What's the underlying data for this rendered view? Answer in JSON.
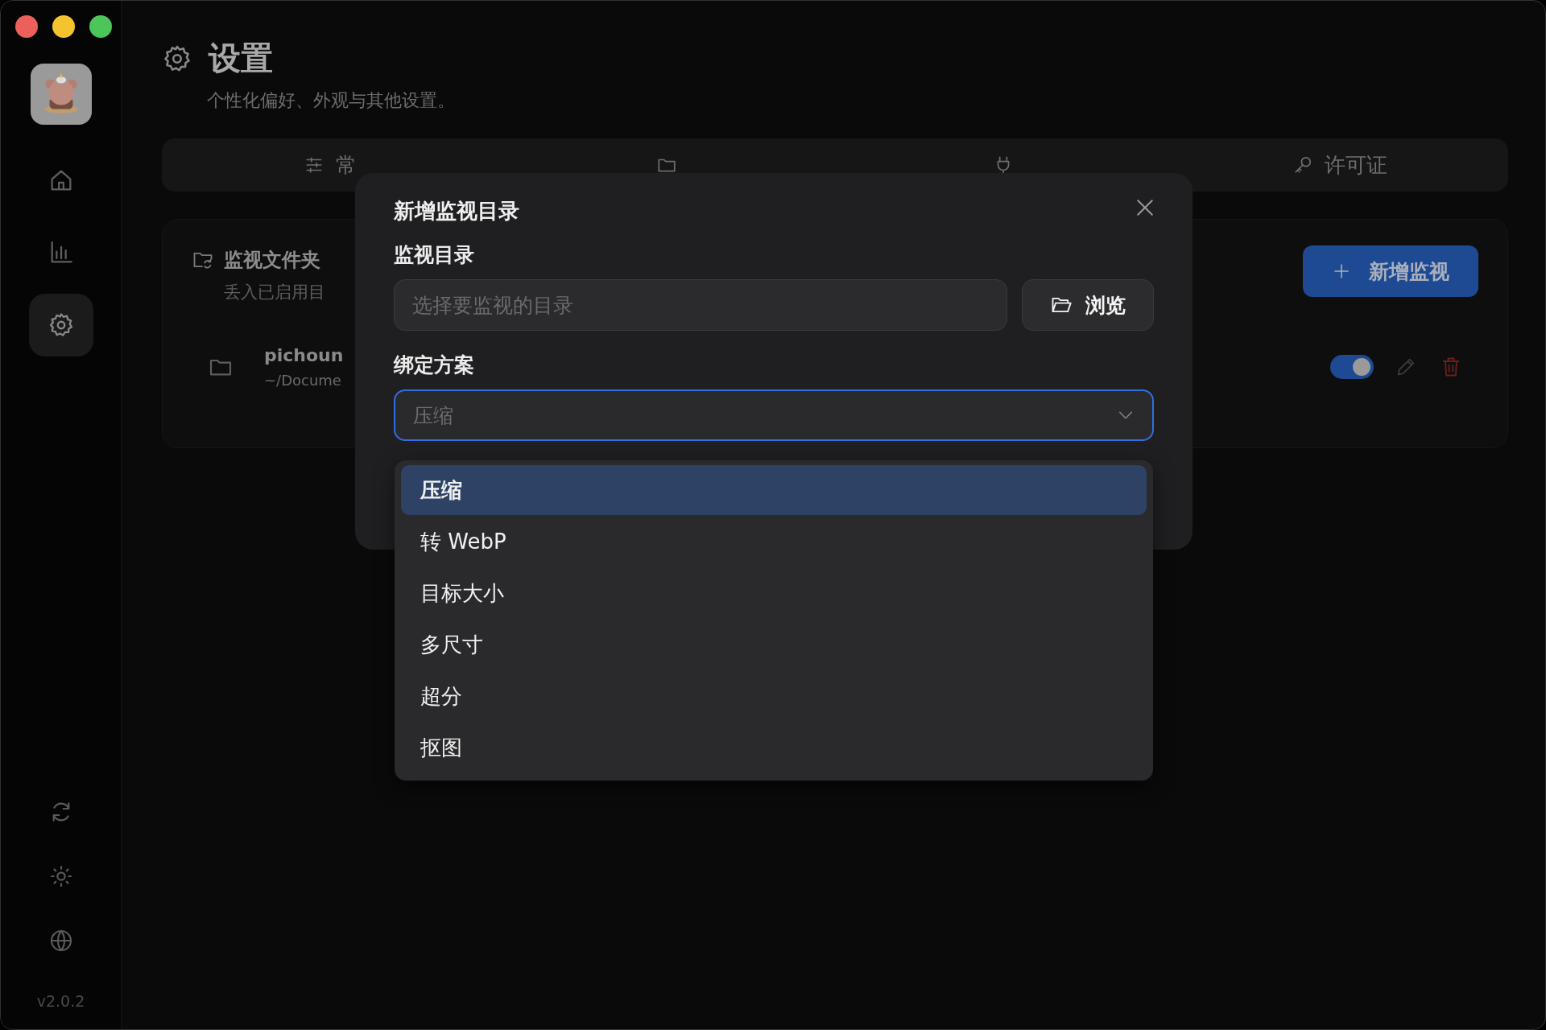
{
  "window": {
    "controls": [
      {
        "kind": "close"
      },
      {
        "kind": "minimize"
      },
      {
        "kind": "zoom"
      }
    ]
  },
  "sidebar": {
    "items": [
      {
        "kind": "home",
        "selected": false
      },
      {
        "kind": "stats",
        "selected": false
      },
      {
        "kind": "settings",
        "selected": true
      }
    ],
    "footer": [
      {
        "kind": "refresh"
      },
      {
        "kind": "theme"
      },
      {
        "kind": "language"
      }
    ],
    "version": "v2.0.2"
  },
  "header": {
    "title": "设置",
    "subtitle": "个性化偏好、外观与其他设置。"
  },
  "tabs": [
    {
      "kind": "general",
      "label": "常"
    },
    {
      "kind": "automation"
    },
    {
      "kind": "plugins"
    },
    {
      "kind": "license",
      "label": "许可证"
    }
  ],
  "watch_card": {
    "title": "监视文件夹",
    "subtitle": "丢入已启用目",
    "add_button": "新增监视",
    "folders": [
      {
        "name": "pichoun",
        "path": "~/Docume",
        "enabled": true
      }
    ]
  },
  "dialog": {
    "title": "新增监视目录",
    "directory_label": "监视目录",
    "directory_field": {
      "placeholder": "选择要监视的目录"
    },
    "browse_button": "浏览",
    "preset_label": "绑定方案",
    "preset_select": {
      "value": "压缩",
      "expanded": true
    },
    "options": [
      {
        "label": "压缩",
        "selected": true
      },
      {
        "label": "转 WebP",
        "selected": false
      },
      {
        "label": "目标大小",
        "selected": false
      },
      {
        "label": "多尺寸",
        "selected": false
      },
      {
        "label": "超分",
        "selected": false
      },
      {
        "label": "抠图",
        "selected": false
      }
    ]
  }
}
